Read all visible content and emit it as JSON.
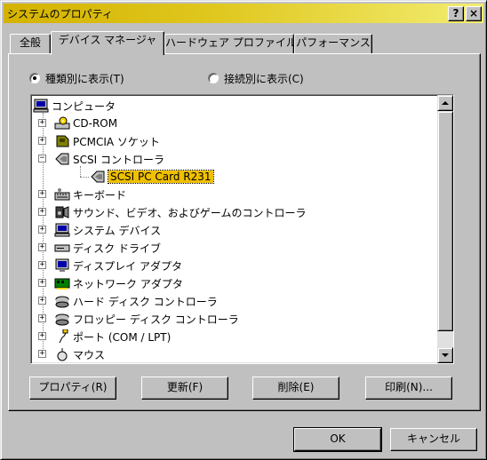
{
  "window": {
    "title": "システムのプロパティ",
    "help_button": "?",
    "close_button": "×"
  },
  "tabs": [
    {
      "label": "全般",
      "active": false
    },
    {
      "label": "デバイス マネージャ",
      "active": true
    },
    {
      "label": "ハードウェア プロファイル",
      "active": false
    },
    {
      "label": "パフォーマンス",
      "active": false
    }
  ],
  "view_options": {
    "by_type": "種類別に表示(T)",
    "by_connection": "接続別に表示(C)",
    "selected": "by_type"
  },
  "tree": {
    "root": "コンピュータ",
    "items": [
      {
        "label": "CD-ROM",
        "icon": "cdrom-icon"
      },
      {
        "label": "PCMCIA ソケット",
        "icon": "pcmcia-icon"
      },
      {
        "label": "SCSI コントローラ",
        "icon": "scsi-icon",
        "expanded": true
      },
      {
        "label": "SCSI PC Card R231",
        "icon": "scsi-icon",
        "selected": true
      },
      {
        "label": "キーボード",
        "icon": "keyboard-icon"
      },
      {
        "label": "サウンド、ビデオ、およびゲームのコントローラ",
        "icon": "sound-icon"
      },
      {
        "label": "システム デバイス",
        "icon": "system-icon"
      },
      {
        "label": "ディスク ドライブ",
        "icon": "disk-icon"
      },
      {
        "label": "ディスプレイ アダプタ",
        "icon": "display-icon"
      },
      {
        "label": "ネットワーク アダプタ",
        "icon": "network-icon"
      },
      {
        "label": "ハード ディスク コントローラ",
        "icon": "hdd-controller-icon"
      },
      {
        "label": "フロッピー ディスク コントローラ",
        "icon": "floppy-controller-icon"
      },
      {
        "label": "ポート (COM / LPT)",
        "icon": "port-icon"
      },
      {
        "label": "マウス",
        "icon": "mouse-icon"
      }
    ]
  },
  "actions": {
    "properties": "プロパティ(R)",
    "refresh": "更新(F)",
    "remove": "削除(E)",
    "print": "印刷(N)..."
  },
  "footer": {
    "ok": "OK",
    "cancel": "キャンセル"
  },
  "colors": {
    "titlebar_start": "#d4b200",
    "titlebar_end": "#f2ec70",
    "selection": "#f0c000",
    "face": "#c0c0c0"
  }
}
